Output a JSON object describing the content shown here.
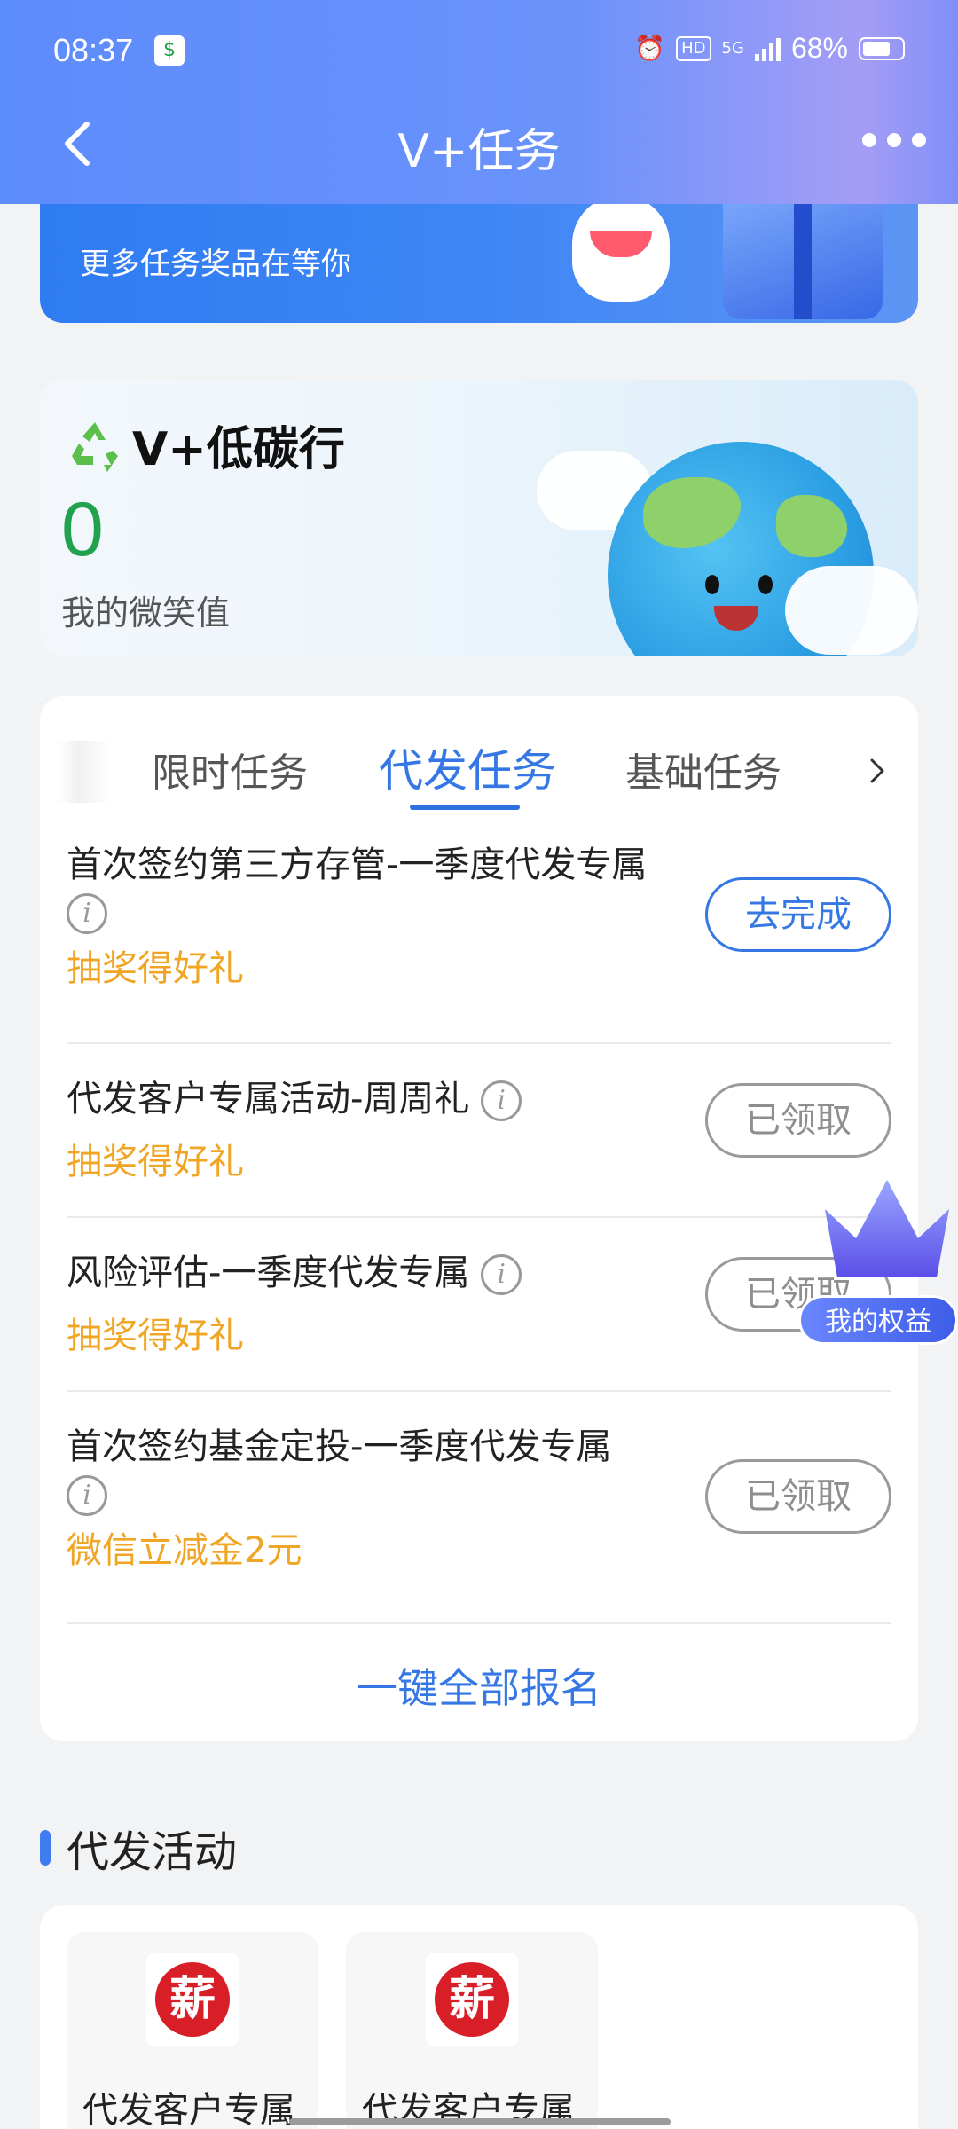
{
  "status_bar": {
    "time": "08:37",
    "battery_percent": "68%",
    "network": "5G",
    "hd_label": "HD"
  },
  "nav": {
    "title": "V+任务"
  },
  "banner": {
    "subtitle": "更多任务奖品在等你"
  },
  "carbon": {
    "title": "V+低碳行",
    "value": "0",
    "value_label": "我的微笑值"
  },
  "tabs": {
    "items": [
      "限时任务",
      "代发任务",
      "基础任务"
    ],
    "active": "代发任务"
  },
  "tasks": [
    {
      "title": "首次签约第三方存管-一季度代发专属",
      "reward": "抽奖得好礼",
      "button": "去完成",
      "status": "todo"
    },
    {
      "title": "代发客户专属活动-周周礼",
      "reward": "抽奖得好礼",
      "button": "已领取",
      "status": "done"
    },
    {
      "title": "风险评估-一季度代发专属",
      "reward": "抽奖得好礼",
      "button": "已领取",
      "status": "done"
    },
    {
      "title": "首次签约基金定投-一季度代发专属",
      "reward": "微信立减金2元",
      "button": "已领取",
      "status": "done"
    }
  ],
  "enroll_all_label": "一键全部报名",
  "rights_label": "我的权益",
  "section": {
    "title": "代发活动",
    "cards": [
      {
        "logo_char": "薪",
        "label": "代发客户专属"
      },
      {
        "logo_char": "薪",
        "label": "代发客户专属"
      }
    ]
  },
  "colors": {
    "accent": "#3578e5",
    "reward": "#f0a524",
    "smile_value": "#21a24e"
  }
}
